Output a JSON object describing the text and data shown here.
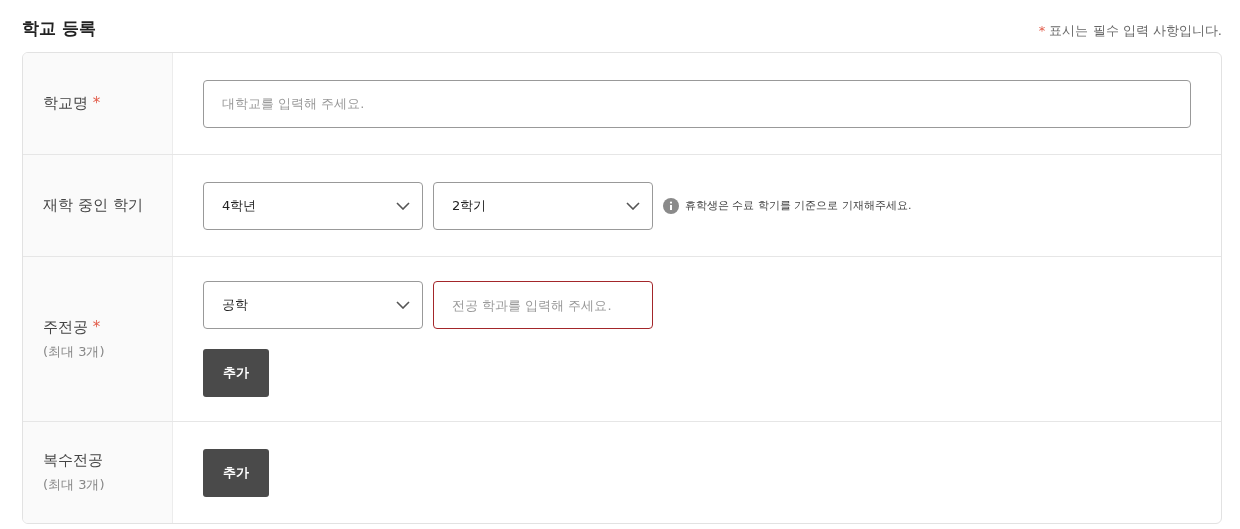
{
  "title": "학교 등록",
  "required_note": {
    "mark": "*",
    "text": "표시는 필수 입력 사항입니다."
  },
  "required_mark": "*",
  "rows": [
    {
      "label": "학교명",
      "required": true,
      "fields": [
        {
          "kind": "input",
          "placeholder": "대학교를 입력해 주세요.",
          "invalid": false
        }
      ]
    },
    {
      "label": "재학 중인 학기",
      "required": false,
      "fields": [
        {
          "kind": "select",
          "value": "4학년"
        },
        {
          "kind": "select",
          "value": "2학기"
        },
        {
          "kind": "info",
          "text": "휴학생은 수료 학기를 기준으로 기재해주세요."
        }
      ]
    },
    {
      "label": "주전공",
      "required": true,
      "sublabel": "(최대 3개)",
      "fields": [
        {
          "kind": "select",
          "value": "공학"
        },
        {
          "kind": "input",
          "placeholder": "전공 학과를 입력해 주세요.",
          "invalid": true
        },
        {
          "kind": "button",
          "label": "추가"
        }
      ]
    },
    {
      "label": "복수전공",
      "required": false,
      "sublabel": "(최대 3개)",
      "fields": [
        {
          "kind": "button",
          "label": "추가"
        }
      ]
    }
  ]
}
